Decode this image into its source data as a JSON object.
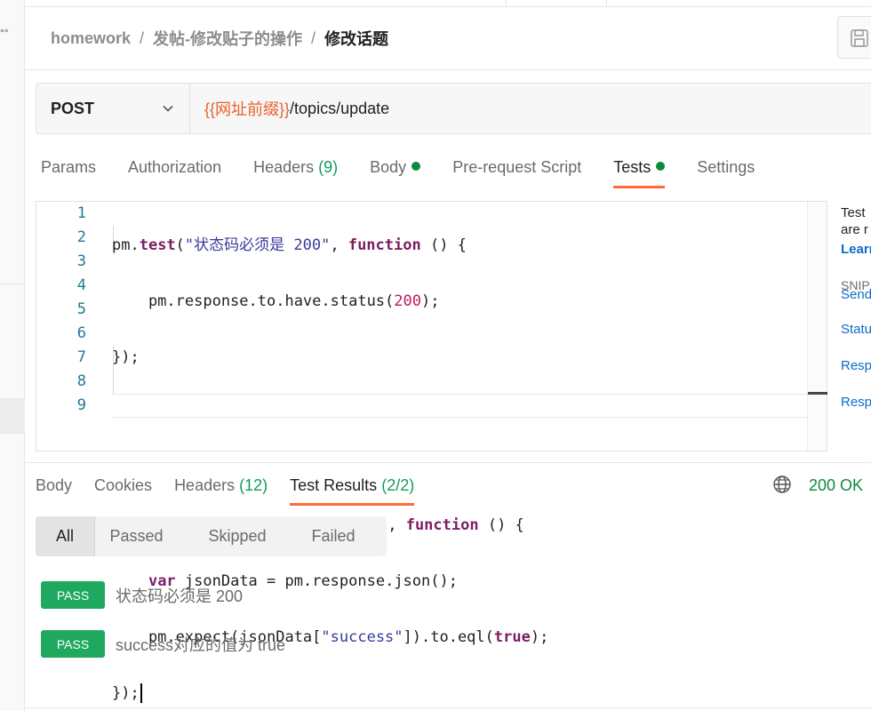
{
  "sidebar": {
    "dots": "°°"
  },
  "breadcrumb": {
    "items": [
      "homework",
      "发帖-修改贴子的操作",
      "修改话题"
    ],
    "separator": "/"
  },
  "save_icon": "save-icon",
  "request": {
    "method": "POST",
    "url_variable": "{{网址前缀}}",
    "url_path": "/topics/update"
  },
  "request_tabs": {
    "params": "Params",
    "authorization": "Authorization",
    "headers": "Headers",
    "headers_count": "(9)",
    "body": "Body",
    "pre_request": "Pre-request Script",
    "tests": "Tests",
    "settings": "Settings",
    "active": "Tests"
  },
  "editor": {
    "line_numbers": [
      "1",
      "2",
      "3",
      "4",
      "5",
      "6",
      "7",
      "8",
      "9"
    ],
    "lines": [
      "pm.test(\"状态码必须是 200\", function () {",
      "    pm.response.to.have.status(200);",
      "});",
      "",
      "",
      "pm.test(\"success对应的值为 true\", function () {",
      "    var jsonData = pm.response.json();",
      "    pm.expect(jsonData[\"success\"]).to.eql(true);",
      "});"
    ]
  },
  "side_panel": {
    "desc_line1": "Test",
    "desc_line2": "are r",
    "learn": "Learn",
    "snippets": "SNIP",
    "links": [
      "Send",
      "Statu",
      "Resp",
      "Resp"
    ]
  },
  "response_tabs": {
    "body": "Body",
    "cookies": "Cookies",
    "headers": "Headers",
    "headers_count": "(12)",
    "test_results": "Test Results",
    "test_results_count": "(2/2)",
    "active": "Test Results"
  },
  "response_status": "200 OK",
  "globe_icon": "globe-icon",
  "filters": [
    "All",
    "Passed",
    "Skipped",
    "Failed"
  ],
  "active_filter": "All",
  "results": [
    {
      "status": "PASS",
      "name": "状态码必须是 200"
    },
    {
      "status": "PASS",
      "name": "success对应的值为 true"
    }
  ],
  "colors": {
    "accent": "#ff6c37",
    "pass": "#1fa95f",
    "dot": "#0e8a3f",
    "variable": "#e8622c",
    "link": "#0b6bcb"
  }
}
